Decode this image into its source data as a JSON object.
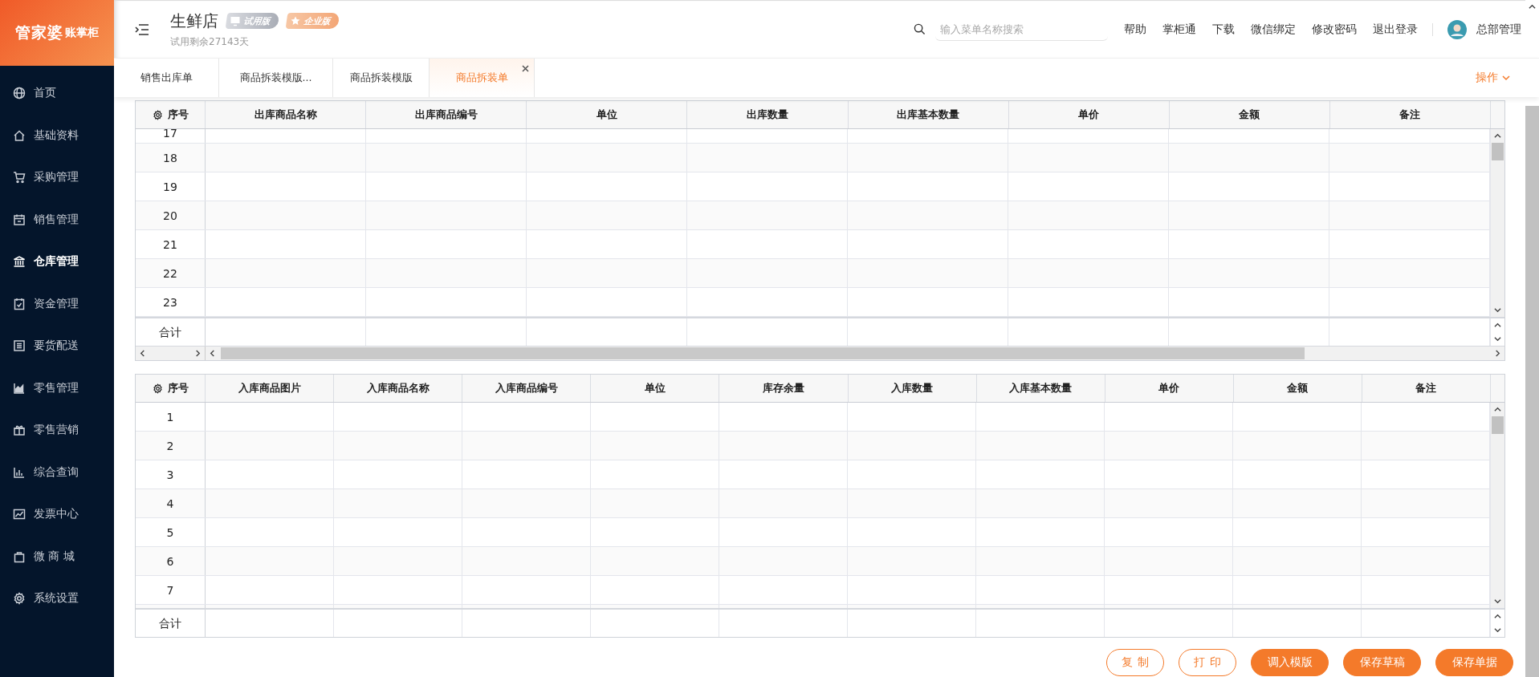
{
  "sidebar": {
    "logo": {
      "brand": "管家婆",
      "product": "账掌柜"
    },
    "items": [
      {
        "label": "首页",
        "selected": false
      },
      {
        "label": "基础资料",
        "selected": false
      },
      {
        "label": "采购管理",
        "selected": false
      },
      {
        "label": "销售管理",
        "selected": false
      },
      {
        "label": "仓库管理",
        "selected": true
      },
      {
        "label": "资金管理",
        "selected": false
      },
      {
        "label": "要货配送",
        "selected": false
      },
      {
        "label": "零售管理",
        "selected": false
      },
      {
        "label": "零售营销",
        "selected": false
      },
      {
        "label": "综合查询",
        "selected": false
      },
      {
        "label": "发票中心",
        "selected": false
      },
      {
        "label": "微 商 城",
        "selected": false
      },
      {
        "label": "系统设置",
        "selected": false
      }
    ]
  },
  "header": {
    "store_name": "生鲜店",
    "badges": [
      {
        "label": "试用版",
        "kind": "trial"
      },
      {
        "label": "企业版",
        "kind": "enterprise"
      }
    ],
    "trial_note": "试用剩余27143天",
    "search": {
      "placeholder": "输入菜单名称搜索"
    },
    "links": [
      "帮助",
      "掌柜通",
      "下载",
      "微信绑定",
      "修改密码",
      "退出登录"
    ],
    "user": "总部管理"
  },
  "tabs": [
    {
      "label": "销售出库单",
      "selected": false,
      "closable": false
    },
    {
      "label": "商品拆装模版...",
      "selected": false,
      "closable": false
    },
    {
      "label": "商品拆装模版",
      "selected": false,
      "closable": false
    },
    {
      "label": "商品拆装单",
      "selected": true,
      "closable": true
    }
  ],
  "actions_menu": "操作",
  "outbound_table": {
    "columns": [
      "序号",
      "出库商品名称",
      "出库商品编号",
      "单位",
      "出库数量",
      "出库基本数量",
      "单价",
      "金额",
      "备注"
    ],
    "rows": [
      "17",
      "18",
      "19",
      "20",
      "21",
      "22",
      "23"
    ],
    "total_label": "合计"
  },
  "inbound_table": {
    "columns": [
      "序号",
      "入库商品图片",
      "入库商品名称",
      "入库商品编号",
      "单位",
      "库存余量",
      "入库数量",
      "入库基本数量",
      "单价",
      "金额",
      "备注"
    ],
    "rows": [
      "1",
      "2",
      "3",
      "4",
      "5",
      "6",
      "7"
    ],
    "total_label": "合计"
  },
  "buttons": [
    {
      "label": "复制",
      "kind": "outline"
    },
    {
      "label": "打印",
      "kind": "outline"
    },
    {
      "label": "调入模版",
      "kind": "solid"
    },
    {
      "label": "保存草稿",
      "kind": "solid"
    },
    {
      "label": "保存单据",
      "kind": "solid"
    }
  ]
}
